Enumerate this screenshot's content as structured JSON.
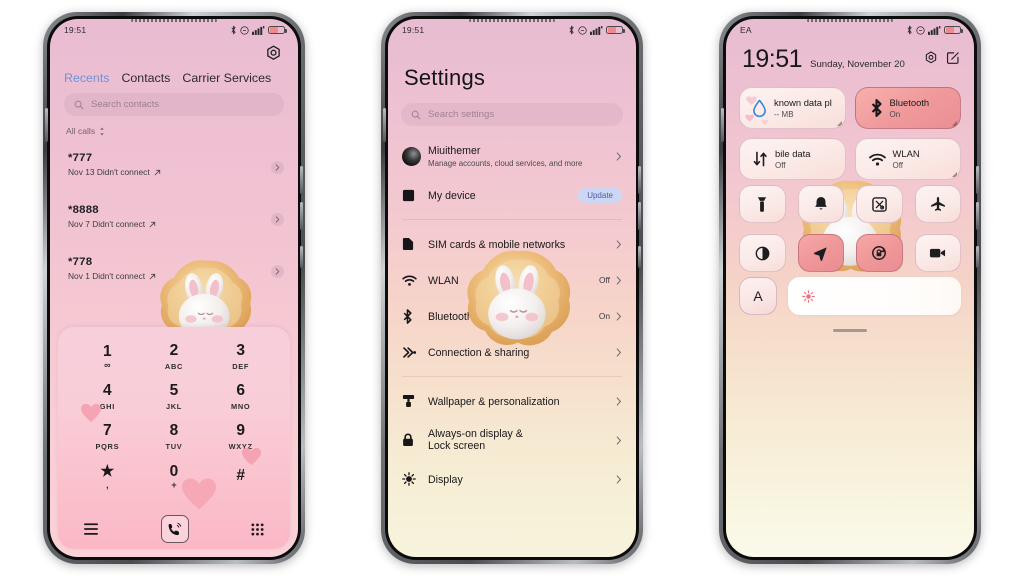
{
  "meta": {
    "background_color": "#ffffff"
  },
  "phones": {
    "dialer": {
      "statusbar": {
        "time": "19:51",
        "icons": [
          "bluetooth-icon",
          "dnd-icon",
          "signal-icon",
          "battery-icon"
        ]
      },
      "gear_icon": "settings-gear-icon",
      "tabs": [
        {
          "label": "Recents",
          "active": true,
          "color": "#6f93db"
        },
        {
          "label": "Contacts",
          "active": false
        },
        {
          "label": "Carrier Services",
          "active": false
        }
      ],
      "search": {
        "placeholder": "Search contacts",
        "icon": "search-icon"
      },
      "filter": {
        "label": "All calls",
        "icon": "sort-updown-icon"
      },
      "calls": [
        {
          "number": "*777",
          "detail": "Nov 13 Didn't connect",
          "direction_icon": "outgoing-arrow-icon"
        },
        {
          "number": "*8888",
          "detail": "Nov 7 Didn't connect",
          "direction_icon": "outgoing-arrow-icon"
        },
        {
          "number": "*778",
          "detail": "Nov 1 Didn't connect",
          "direction_icon": "outgoing-arrow-icon"
        }
      ],
      "dialpad": {
        "keys": [
          {
            "digit": "1",
            "letters": "∞"
          },
          {
            "digit": "2",
            "letters": "ABC"
          },
          {
            "digit": "3",
            "letters": "DEF"
          },
          {
            "digit": "4",
            "letters": "GHI"
          },
          {
            "digit": "5",
            "letters": "JKL"
          },
          {
            "digit": "6",
            "letters": "MNO"
          },
          {
            "digit": "7",
            "letters": "PQRS"
          },
          {
            "digit": "8",
            "letters": "TUV"
          },
          {
            "digit": "9",
            "letters": "WXYZ"
          },
          {
            "digit": "★",
            "letters": ","
          },
          {
            "digit": "0",
            "letters": "+"
          },
          {
            "digit": "#",
            "letters": ""
          }
        ],
        "footer": {
          "menu_icon": "menu-lines-icon",
          "call_icon": "call-handset-icon",
          "keypad_icon": "keypad-grid-icon"
        }
      },
      "mascot": "bunny-in-cookie-icon"
    },
    "settings": {
      "statusbar": {
        "time": "19:51"
      },
      "title": "Settings",
      "search": {
        "placeholder": "Search settings",
        "icon": "search-icon"
      },
      "groups": [
        {
          "rows": [
            {
              "label": "Miuithemer",
              "sub": "Manage accounts, cloud services, and more",
              "icon": "account-avatar-icon",
              "chevron": true
            },
            {
              "label": "My device",
              "icon": "device-square-icon",
              "badge": "Update"
            }
          ]
        },
        {
          "rows": [
            {
              "label": "SIM cards & mobile networks",
              "icon": "sim-card-icon",
              "chevron": true
            },
            {
              "label": "WLAN",
              "icon": "wifi-icon",
              "value": "Off",
              "chevron": true
            },
            {
              "label": "Bluetooth",
              "icon": "bluetooth-icon",
              "value": "On",
              "chevron": true
            },
            {
              "label": "Connection & sharing",
              "icon": "connection-sharing-icon",
              "chevron": true
            }
          ]
        },
        {
          "rows": [
            {
              "label": "Wallpaper & personalization",
              "icon": "paint-roller-icon",
              "chevron": true
            },
            {
              "label": "Always-on display & Lock screen",
              "icon": "lock-icon",
              "chevron": true
            },
            {
              "label": "Display",
              "icon": "brightness-sun-icon",
              "chevron": true
            }
          ]
        }
      ],
      "mascot": "bunny-in-cookie-icon"
    },
    "control_center": {
      "statusbar": {
        "carrier": "EA"
      },
      "clock": {
        "time": "19:51",
        "date": "Sunday, November 20"
      },
      "header_icons": [
        "settings-gear-icon",
        "edit-pencil-icon"
      ],
      "big_tiles": [
        {
          "title": "Unknown data plan",
          "sub": "-- MB",
          "icon": "data-drop-icon",
          "on": false,
          "truncated": "known data pl"
        },
        {
          "title": "Bluetooth",
          "sub": "On",
          "icon": "bluetooth-icon",
          "on": true
        },
        {
          "title": "Mobile data",
          "sub": "Off",
          "icon": "data-arrows-icon",
          "on": false,
          "truncated": "bile data"
        },
        {
          "title": "WLAN",
          "sub": "Off",
          "icon": "wifi-icon",
          "on": false
        }
      ],
      "toggles": [
        {
          "icon": "flashlight-icon",
          "on": false
        },
        {
          "icon": "bell-ring-icon",
          "on": false
        },
        {
          "icon": "screenshot-scissors-icon",
          "on": false
        },
        {
          "icon": "airplane-icon",
          "on": false
        },
        {
          "icon": "dark-mode-contrast-icon",
          "on": false
        },
        {
          "icon": "location-arrow-icon",
          "on": true
        },
        {
          "icon": "auto-rotate-lock-icon",
          "on": true
        },
        {
          "icon": "screen-record-icon",
          "on": false
        }
      ],
      "bottom": {
        "auto_brightness_label": "A",
        "brightness_icon": "brightness-sun-icon"
      },
      "mascot": "bunny-in-cookie-icon"
    }
  }
}
